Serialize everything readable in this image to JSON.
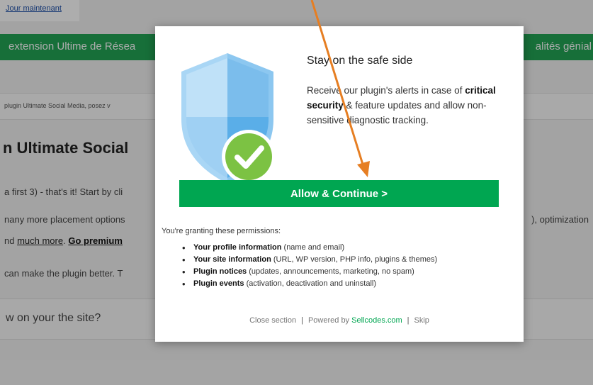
{
  "background": {
    "top_link": "Jour maintenant",
    "banner_left": "extension Ultime de Résea",
    "banner_right": "alités génial",
    "infobar_text": "plugin Ultimate Social Media, posez v",
    "heading": "n Ultimate Social",
    "line1": "a first 3) - that's it! Start by cli",
    "line2_prefix": "nany more placement options",
    "line2_right": "), optimization",
    "line3_prefix": "nd ",
    "line3_link": "much more",
    "line3_sep": ". ",
    "line3_bold": "Go premium",
    "line4": "can make the plugin better. T",
    "question": "w on your the site?"
  },
  "modal": {
    "title": "Stay on the safe side",
    "desc_part1": "Receive our plugin's alerts in case of ",
    "desc_bold": "critical security",
    "desc_part2": " & feature updates and allow non-sensitive diagnostic tracking.",
    "cta_label": "Allow & Continue  >",
    "permissions_title": "You're granting these permissions:",
    "permissions": [
      {
        "name": "Your profile information",
        "detail": " (name and email)"
      },
      {
        "name": "Your site information",
        "detail": " (URL, WP version, PHP info, plugins & themes)"
      },
      {
        "name": "Plugin notices",
        "detail": " (updates, announcements, marketing, no spam)"
      },
      {
        "name": "Plugin events",
        "detail": " (activation, deactivation and uninstall)"
      }
    ],
    "footer": {
      "close_label": "Close section",
      "sep1": "|",
      "powered_prefix": "Powered by ",
      "brand": "Sellcodes.com",
      "sep2": "|",
      "skip_label": "Skip"
    }
  },
  "colors": {
    "cta": "#00a651",
    "banner": "#23a455",
    "shield_light": "#a9d6f5",
    "shield_dark": "#5aaee8",
    "check_badge": "#7cc243",
    "arrow": "#e67e22"
  },
  "icons": {
    "shield": "shield-check-icon",
    "arrow": "annotation-arrow"
  }
}
